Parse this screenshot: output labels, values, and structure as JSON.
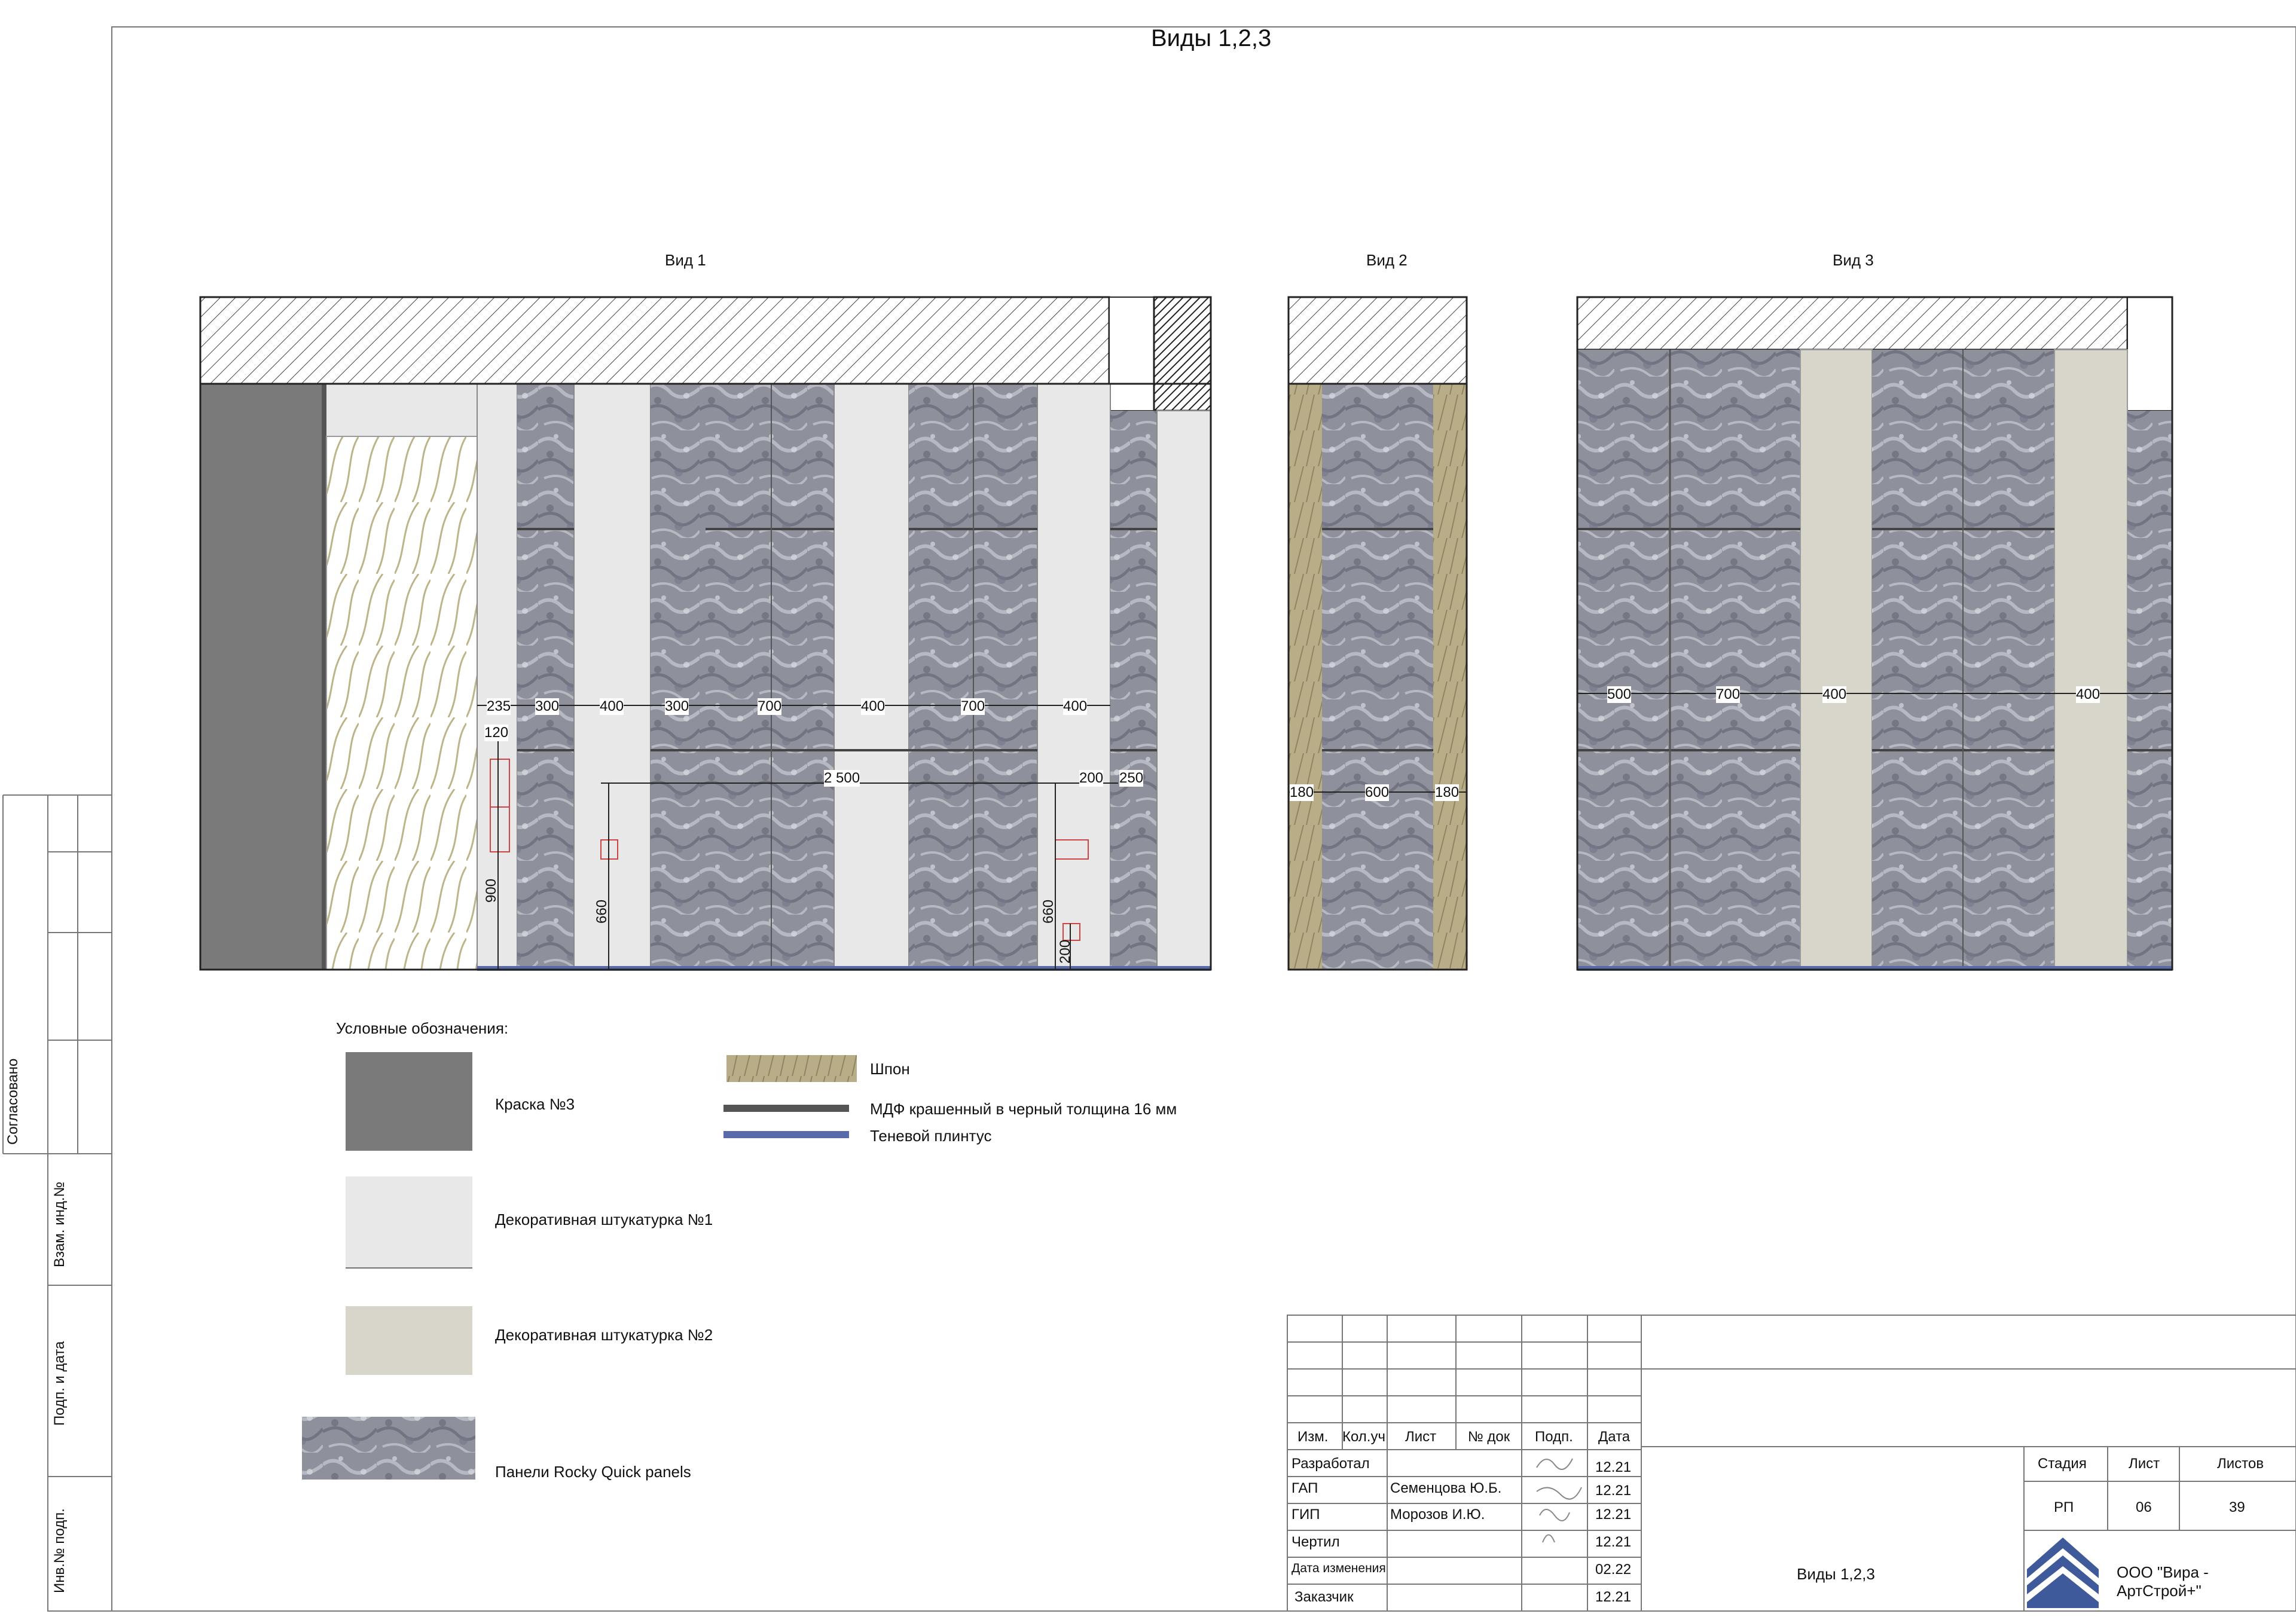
{
  "sheet": {
    "title": "Виды 1,2,3"
  },
  "views": [
    {
      "title": "Вид 1"
    },
    {
      "title": "Вид 2"
    },
    {
      "title": "Вид 3"
    }
  ],
  "view1_dims": {
    "widths": [
      "235",
      "300",
      "400",
      "300",
      "700",
      "400",
      "700",
      "400"
    ],
    "d120": "120",
    "d2500": "2 500",
    "d200": "200",
    "d250": "250",
    "d900": "900",
    "d660a": "660",
    "d660b": "660",
    "d200v": "200"
  },
  "view2_dims": [
    "180",
    "600",
    "180"
  ],
  "view3_dims": [
    "500",
    "700",
    "400",
    "400"
  ],
  "legend": {
    "heading": "Условные обозначения:",
    "items": [
      {
        "label": "Краска №3",
        "color": "#7a7a7a"
      },
      {
        "label": "Декоративная штукатурка №1",
        "color": "#e8e8e8"
      },
      {
        "label": "Декоративная штукатурка №2",
        "color": "#d8d6cb"
      },
      {
        "label": "Панели Rocky Quick panels",
        "color": "#8c8d97"
      },
      {
        "label": "Шпон",
        "color": "#b8ad86"
      },
      {
        "label": "МДФ крашенный в черный толщина 16 мм",
        "color": "#555555"
      },
      {
        "label": "Теневой плинтус",
        "color": "#5a6aa8"
      }
    ]
  },
  "side_stamp": [
    "Согласовано",
    "Взам. инд.№",
    "Подп. и дата",
    "Инв.№ подп."
  ],
  "title_block": {
    "headers": [
      "Изм.",
      "Кол.уч",
      "Лист",
      "№ док",
      "Подп.",
      "Дата"
    ],
    "rows": [
      {
        "role": "Разработал",
        "name": "",
        "date": "12.21"
      },
      {
        "role": "ГАП",
        "name": "Семенцова Ю.Б.",
        "date": "12.21"
      },
      {
        "role": "ГИП",
        "name": "Морозов И.Ю.",
        "date": "12.21"
      },
      {
        "role": "Чертил",
        "name": "",
        "date": "12.21"
      },
      {
        "role": "Дата изменения",
        "name": "",
        "date": "02.22"
      },
      {
        "role": "Заказчик",
        "name": "",
        "date": "12.21"
      }
    ],
    "sheet_name": "Виды 1,2,3",
    "stage_header": "Стадия",
    "sheet_header": "Лист",
    "sheets_header": "Листов",
    "stage": "РП",
    "sheet": "06",
    "sheets": "39",
    "company": "ООО \"Вира - АртСтрой+\"",
    "logo_color": "#3f5a9a"
  }
}
